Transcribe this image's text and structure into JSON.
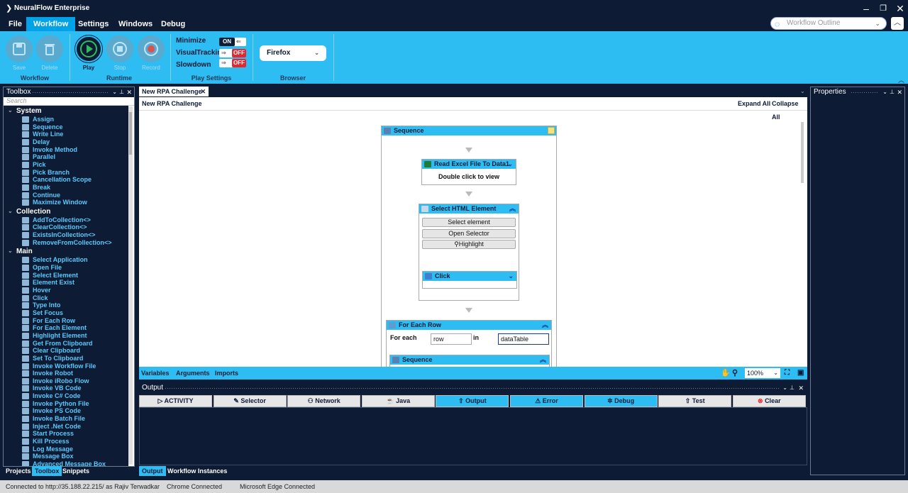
{
  "app": {
    "title": "NeuralFlow Enterprise"
  },
  "menu": [
    "File",
    "Workflow",
    "Settings",
    "Windows",
    "Debug"
  ],
  "search": {
    "placeholder": "Workflow Outline"
  },
  "ribbon": {
    "workflow": {
      "save": "Save",
      "delete": "Delete",
      "group": "Workflow"
    },
    "runtime": {
      "play": "Play",
      "stop": "Stop",
      "record": "Record",
      "group": "Runtime"
    },
    "play_settings": {
      "group": "Play Settings",
      "minimize": {
        "label": "Minimize",
        "state": "ON"
      },
      "visual_tracking": {
        "label": "VisualTracking",
        "state": "OFF"
      },
      "slowdown": {
        "label": "Slowdown",
        "state": "OFF"
      }
    },
    "browser": {
      "value": "Firefox",
      "group": "Browser"
    }
  },
  "toolbox": {
    "title": "Toolbox",
    "search_placeholder": "Search",
    "categories": [
      {
        "name": "System",
        "items": [
          "Assign",
          "Sequence",
          "Write Line",
          "Delay",
          "Invoke Method",
          "Parallel",
          "Pick",
          "Pick Branch",
          "Cancellation Scope",
          "Break",
          "Continue",
          "Maximize Window"
        ]
      },
      {
        "name": "Collection",
        "items": [
          "AddToCollection<>",
          "ClearCollection<>",
          "ExistsInCollection<>",
          "RemoveFromCollection<>"
        ]
      },
      {
        "name": "Main",
        "items": [
          "Select Application",
          "Open File",
          "Select Element",
          "Element Exist",
          "Hover",
          "Click",
          "Type Into",
          "Set Focus",
          "For Each Row",
          "For Each Element",
          "Highlight Element",
          "Get From Clipboard",
          "Clear Clipboard",
          "Set To Clipboard",
          "Invoke Workflow File",
          "Invoke Robot",
          "Invoke iRobo Flow",
          "Invoke VB Code",
          "Invoke C# Code",
          "Invoke Python File",
          "Invoke PS Code",
          "Invoke Batch File",
          "Inject .Net Code",
          "Start Process",
          "Kill Process",
          "Log Message",
          "Message Box",
          "Advanced Message Box"
        ]
      }
    ],
    "bottom_tabs": [
      "Projects",
      "Toolbox",
      "Snippets"
    ]
  },
  "designer": {
    "tab": "New RPA Challenge",
    "breadcrumb": "New RPA Challenge",
    "expand_all": "Expand All",
    "collapse_all": "Collapse All",
    "sequence_title": "Sequence",
    "read_excel": {
      "title": "Read Excel File To Data1",
      "body": "Double click to view"
    },
    "select_html": {
      "title": "Select HTML Element",
      "btn_select": "Select element",
      "btn_open": "Open Selector",
      "btn_highlight": "Highlight"
    },
    "click_title": "Click",
    "for_each": {
      "title": "For Each Row",
      "label": "For each",
      "var": "row",
      "in": "in",
      "collection": "dataTable"
    },
    "inner_sequence": "Sequence",
    "footer_tabs": [
      "Variables",
      "Arguments",
      "Imports"
    ],
    "zoom": "100%"
  },
  "output": {
    "title": "Output",
    "buttons": [
      "ACTIVITY",
      "Selector",
      "Network",
      "Java",
      "Output",
      "Error",
      "Debug",
      "Test",
      "Clear"
    ],
    "tabs": [
      "Output",
      "Workflow Instances"
    ]
  },
  "properties": {
    "title": "Properties"
  },
  "status": {
    "connection": "Connected to http://35.188.22.215/ as Rajiv Terwadkar",
    "chrome": "Chrome Connected",
    "edge": "Microsoft Edge Connected"
  },
  "colors": {
    "accent": "#2ebdf3",
    "dark": "#0d1b35",
    "off": "#e8262b"
  }
}
